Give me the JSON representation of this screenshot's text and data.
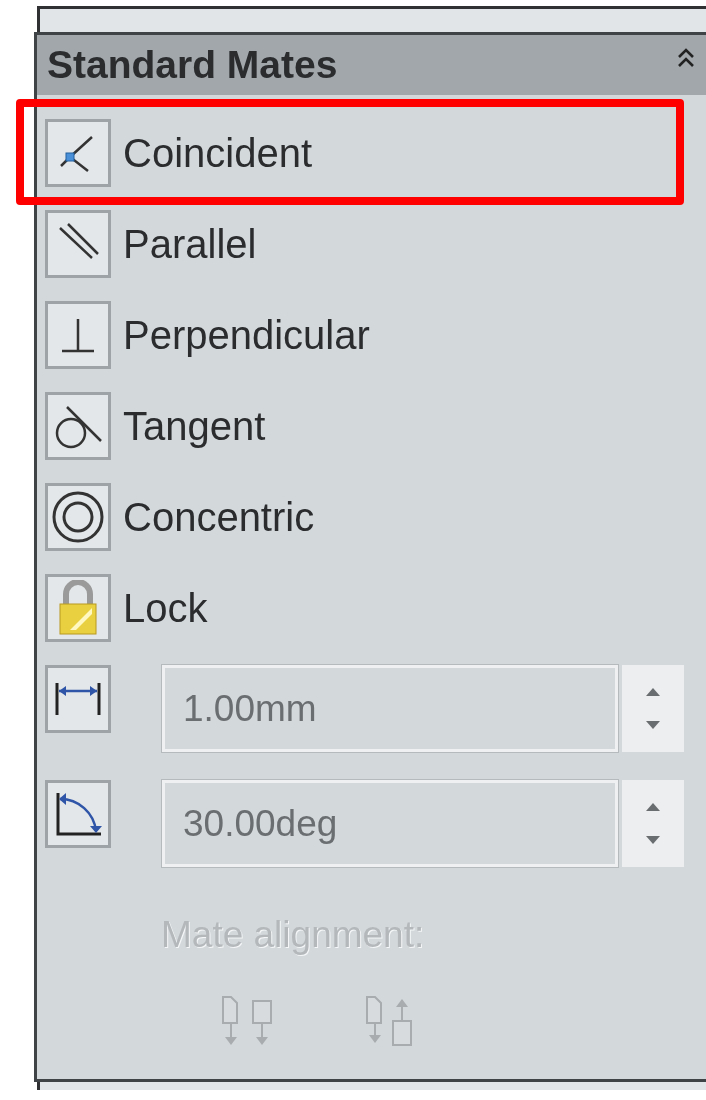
{
  "section": {
    "title": "Standard Mates",
    "expanded": true
  },
  "mates": [
    {
      "label": "Coincident",
      "highlighted": true
    },
    {
      "label": "Parallel",
      "highlighted": false
    },
    {
      "label": "Perpendicular",
      "highlighted": false
    },
    {
      "label": "Tangent",
      "highlighted": false
    },
    {
      "label": "Concentric",
      "highlighted": false
    },
    {
      "label": "Lock",
      "highlighted": false
    }
  ],
  "fields": [
    {
      "value": "1.00mm",
      "disabled": true
    },
    {
      "value": "30.00deg",
      "disabled": true
    }
  ],
  "alignment": {
    "label": "Mate alignment:",
    "disabled": true
  }
}
